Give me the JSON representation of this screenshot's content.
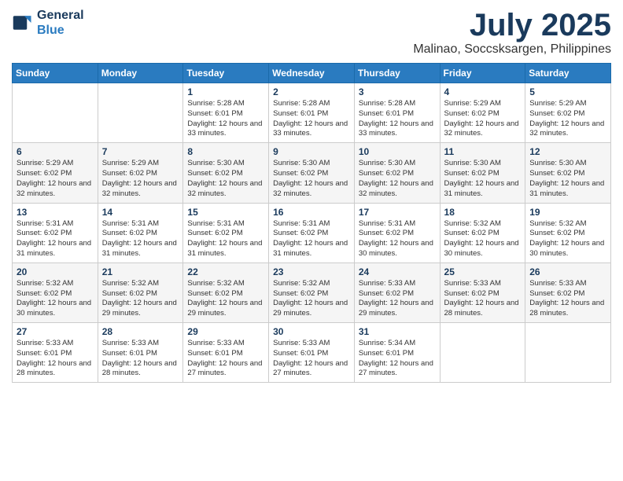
{
  "logo": {
    "line1": "General",
    "line2": "Blue"
  },
  "title": "July 2025",
  "location": "Malinao, Soccsksargen, Philippines",
  "days_of_week": [
    "Sunday",
    "Monday",
    "Tuesday",
    "Wednesday",
    "Thursday",
    "Friday",
    "Saturday"
  ],
  "weeks": [
    [
      {
        "day": "",
        "info": ""
      },
      {
        "day": "",
        "info": ""
      },
      {
        "day": "1",
        "info": "Sunrise: 5:28 AM\nSunset: 6:01 PM\nDaylight: 12 hours and 33 minutes."
      },
      {
        "day": "2",
        "info": "Sunrise: 5:28 AM\nSunset: 6:01 PM\nDaylight: 12 hours and 33 minutes."
      },
      {
        "day": "3",
        "info": "Sunrise: 5:28 AM\nSunset: 6:01 PM\nDaylight: 12 hours and 33 minutes."
      },
      {
        "day": "4",
        "info": "Sunrise: 5:29 AM\nSunset: 6:02 PM\nDaylight: 12 hours and 32 minutes."
      },
      {
        "day": "5",
        "info": "Sunrise: 5:29 AM\nSunset: 6:02 PM\nDaylight: 12 hours and 32 minutes."
      }
    ],
    [
      {
        "day": "6",
        "info": "Sunrise: 5:29 AM\nSunset: 6:02 PM\nDaylight: 12 hours and 32 minutes."
      },
      {
        "day": "7",
        "info": "Sunrise: 5:29 AM\nSunset: 6:02 PM\nDaylight: 12 hours and 32 minutes."
      },
      {
        "day": "8",
        "info": "Sunrise: 5:30 AM\nSunset: 6:02 PM\nDaylight: 12 hours and 32 minutes."
      },
      {
        "day": "9",
        "info": "Sunrise: 5:30 AM\nSunset: 6:02 PM\nDaylight: 12 hours and 32 minutes."
      },
      {
        "day": "10",
        "info": "Sunrise: 5:30 AM\nSunset: 6:02 PM\nDaylight: 12 hours and 32 minutes."
      },
      {
        "day": "11",
        "info": "Sunrise: 5:30 AM\nSunset: 6:02 PM\nDaylight: 12 hours and 31 minutes."
      },
      {
        "day": "12",
        "info": "Sunrise: 5:30 AM\nSunset: 6:02 PM\nDaylight: 12 hours and 31 minutes."
      }
    ],
    [
      {
        "day": "13",
        "info": "Sunrise: 5:31 AM\nSunset: 6:02 PM\nDaylight: 12 hours and 31 minutes."
      },
      {
        "day": "14",
        "info": "Sunrise: 5:31 AM\nSunset: 6:02 PM\nDaylight: 12 hours and 31 minutes."
      },
      {
        "day": "15",
        "info": "Sunrise: 5:31 AM\nSunset: 6:02 PM\nDaylight: 12 hours and 31 minutes."
      },
      {
        "day": "16",
        "info": "Sunrise: 5:31 AM\nSunset: 6:02 PM\nDaylight: 12 hours and 31 minutes."
      },
      {
        "day": "17",
        "info": "Sunrise: 5:31 AM\nSunset: 6:02 PM\nDaylight: 12 hours and 30 minutes."
      },
      {
        "day": "18",
        "info": "Sunrise: 5:32 AM\nSunset: 6:02 PM\nDaylight: 12 hours and 30 minutes."
      },
      {
        "day": "19",
        "info": "Sunrise: 5:32 AM\nSunset: 6:02 PM\nDaylight: 12 hours and 30 minutes."
      }
    ],
    [
      {
        "day": "20",
        "info": "Sunrise: 5:32 AM\nSunset: 6:02 PM\nDaylight: 12 hours and 30 minutes."
      },
      {
        "day": "21",
        "info": "Sunrise: 5:32 AM\nSunset: 6:02 PM\nDaylight: 12 hours and 29 minutes."
      },
      {
        "day": "22",
        "info": "Sunrise: 5:32 AM\nSunset: 6:02 PM\nDaylight: 12 hours and 29 minutes."
      },
      {
        "day": "23",
        "info": "Sunrise: 5:32 AM\nSunset: 6:02 PM\nDaylight: 12 hours and 29 minutes."
      },
      {
        "day": "24",
        "info": "Sunrise: 5:33 AM\nSunset: 6:02 PM\nDaylight: 12 hours and 29 minutes."
      },
      {
        "day": "25",
        "info": "Sunrise: 5:33 AM\nSunset: 6:02 PM\nDaylight: 12 hours and 28 minutes."
      },
      {
        "day": "26",
        "info": "Sunrise: 5:33 AM\nSunset: 6:02 PM\nDaylight: 12 hours and 28 minutes."
      }
    ],
    [
      {
        "day": "27",
        "info": "Sunrise: 5:33 AM\nSunset: 6:01 PM\nDaylight: 12 hours and 28 minutes."
      },
      {
        "day": "28",
        "info": "Sunrise: 5:33 AM\nSunset: 6:01 PM\nDaylight: 12 hours and 28 minutes."
      },
      {
        "day": "29",
        "info": "Sunrise: 5:33 AM\nSunset: 6:01 PM\nDaylight: 12 hours and 27 minutes."
      },
      {
        "day": "30",
        "info": "Sunrise: 5:33 AM\nSunset: 6:01 PM\nDaylight: 12 hours and 27 minutes."
      },
      {
        "day": "31",
        "info": "Sunrise: 5:34 AM\nSunset: 6:01 PM\nDaylight: 12 hours and 27 minutes."
      },
      {
        "day": "",
        "info": ""
      },
      {
        "day": "",
        "info": ""
      }
    ]
  ]
}
